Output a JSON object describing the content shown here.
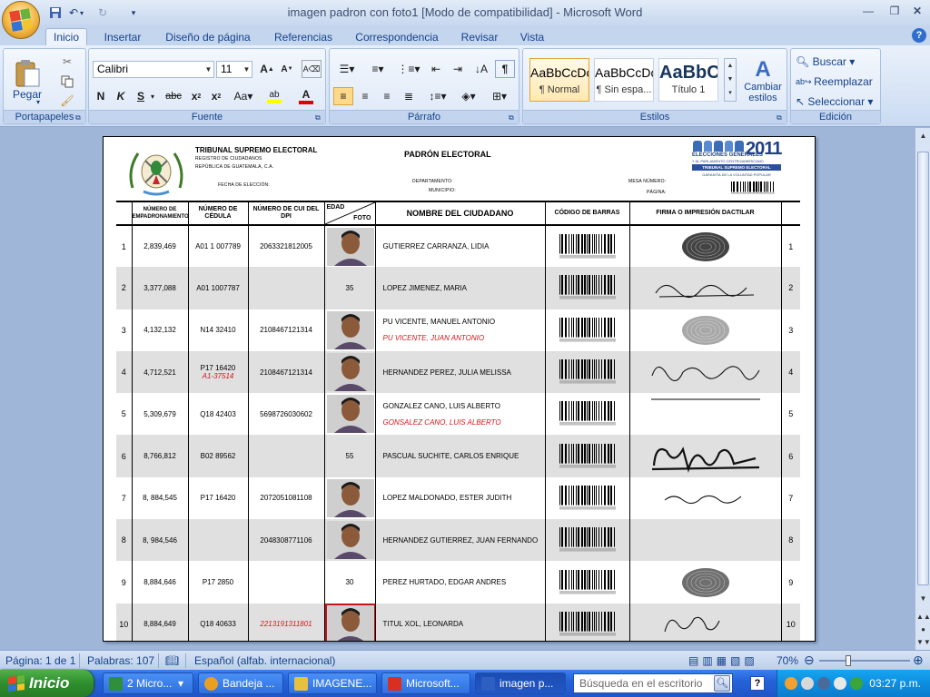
{
  "window": {
    "title": "imagen padron con foto1 [Modo de compatibilidad] - Microsoft Word"
  },
  "tabs": [
    {
      "label": "Inicio",
      "active": true
    },
    {
      "label": "Insertar"
    },
    {
      "label": "Diseño de página"
    },
    {
      "label": "Referencias"
    },
    {
      "label": "Correspondencia"
    },
    {
      "label": "Revisar"
    },
    {
      "label": "Vista"
    }
  ],
  "ribbon": {
    "clipboard": {
      "label": "Portapapeles",
      "paste": "Pegar"
    },
    "font": {
      "label": "Fuente",
      "family": "Calibri",
      "size": "11"
    },
    "paragraph": {
      "label": "Párrafo"
    },
    "styles": {
      "label": "Estilos",
      "items": [
        {
          "sample": "AaBbCcDc",
          "name": "¶ Normal"
        },
        {
          "sample": "AaBbCcDc",
          "name": "¶ Sin espa..."
        },
        {
          "sample": "AaBbC",
          "name": "Título 1"
        }
      ],
      "change": "Cambiar estilos"
    },
    "editing": {
      "label": "Edición",
      "find": "Buscar",
      "replace": "Reemplazar",
      "select": "Seleccionar"
    }
  },
  "page": {
    "org_title": "TRIBUNAL SUPREMO ELECTORAL",
    "org_sub1": "REGISTRO DE CIUDADANOS",
    "org_sub2": "REPÚBLICA DE GUATEMALA,  C.A.",
    "doc_title": "PADRÓN ELECTORAL",
    "fecha_label": "FECHA  DE  ELECCIÓN:",
    "departamento_label": "DEPARTAMENTO:",
    "municipio_label": "MUNICIPIO:",
    "mesa_label": "MESA NÚMERO:",
    "pagina_label": "PÁGINA:",
    "logo_year": "2011",
    "logo_line1": "ELECCIONES GENERALES",
    "logo_line2": "Y AL PARLAMENTO CENTROAMERICANO",
    "logo_line3": "TRIBUNAL SUPREMO ELECTORAL",
    "logo_line4": "GARANTÍA DE LA VOLUNTAD POPULAR"
  },
  "table": {
    "headers": {
      "empadronamiento": "NÚMERO DE EMPADRONAMIENTO",
      "cedula": "NÚMERO DE CÉDULA",
      "cui": "NÚMERO DE CUI DEL DPI",
      "edad": "EDAD",
      "foto": "FOTO",
      "nombre": "NOMBRE DEL CIUDADANO",
      "codigo": "CÓDIGO DE BARRAS",
      "firma": "FIRMA O IMPRESIÓN DACTILAR"
    },
    "rows": [
      {
        "n": "1",
        "emp": "2,839,469",
        "cedula": "A01 1 007789",
        "cedula_note": "",
        "cui": "2063321812005",
        "cui_red": false,
        "age": "",
        "photo": true,
        "name": "GUTIERREZ CARRANZA,  LIDIA",
        "name_note": "",
        "sig": "thumb-dark"
      },
      {
        "n": "2",
        "emp": "3,377,088",
        "cedula": "A01 1007787",
        "cedula_note": "",
        "cui": "",
        "cui_red": false,
        "age": "35",
        "photo": false,
        "name": "LOPEZ JIMENEZ, MARIA",
        "name_note": "",
        "sig": "signature-a"
      },
      {
        "n": "3",
        "emp": "4,132,132",
        "cedula": "N14 32410",
        "cedula_note": "",
        "cui": "2108467121314",
        "cui_red": false,
        "age": "",
        "photo": true,
        "name": "PU VICENTE, MANUEL ANTONIO",
        "name_note": "PU VICENTE, JUAN ANTONIO",
        "sig": "thumb-light"
      },
      {
        "n": "4",
        "emp": "4,712,521",
        "cedula": "P17 16420",
        "cedula_note": "A1-37514",
        "cui": "2108467121314",
        "cui_red": false,
        "age": "",
        "photo": true,
        "name": "HERNANDEZ PEREZ,  JULIA MELISSA",
        "name_note": "",
        "sig": "signature-b"
      },
      {
        "n": "5",
        "emp": "5,309,679",
        "cedula": "Q18 42403",
        "cedula_note": "",
        "cui": "5698726030602",
        "cui_red": false,
        "age": "",
        "photo": true,
        "name": "GONZALEZ CANO,  LUIS ALBERTO",
        "name_note": "GONSALEZ CANO,  LUIS ALBERTO",
        "sig": "line"
      },
      {
        "n": "6",
        "emp": "8,766,812",
        "cedula": "B02 89562",
        "cedula_note": "",
        "cui": "",
        "cui_red": false,
        "age": "55",
        "photo": false,
        "name": "PASCUAL SUCHITE, CARLOS ENRIQUE",
        "name_note": "",
        "sig": "signature-c"
      },
      {
        "n": "7",
        "emp": "8, 884,545",
        "cedula": "P17 16420",
        "cedula_note": "",
        "cui": "2072051081108",
        "cui_red": false,
        "age": "",
        "photo": true,
        "name": "LOPEZ MALDONADO, ESTER JUDITH",
        "name_note": "",
        "sig": "signature-d"
      },
      {
        "n": "8",
        "emp": "8, 984,546",
        "cedula": "",
        "cedula_note": "",
        "cui": "2048308771106",
        "cui_red": false,
        "age": "",
        "photo": true,
        "name": "HERNANDEZ GUTIERREZ,  JUAN  FERNANDO",
        "name_note": "",
        "sig": "none"
      },
      {
        "n": "9",
        "emp": "8,884,646",
        "cedula": "P17 2850",
        "cedula_note": "",
        "cui": "",
        "cui_red": false,
        "age": "30",
        "photo": false,
        "name": "PEREZ HURTADO,  EDGAR  ANDRES",
        "name_note": "",
        "sig": "thumb-mid"
      },
      {
        "n": "10",
        "emp": "8,884,649",
        "cedula": "Q18 40633",
        "cedula_note": "",
        "cui": "2213191311801",
        "cui_red": true,
        "age": "",
        "photo": true,
        "name": "TITUL XOL, LEONARDA",
        "name_note": "",
        "sig": "signature-e"
      }
    ]
  },
  "statusbar": {
    "page": "Página: 1 de 1",
    "words": "Palabras: 107",
    "language": "Español (alfab. internacional)",
    "zoom": "70%"
  },
  "taskbar": {
    "start": "Inicio",
    "buttons": [
      {
        "label": "2 Micro...",
        "color": "#2f8f3a"
      },
      {
        "label": "Bandeja ...",
        "color": "#e8a020"
      },
      {
        "label": "IMAGENE...",
        "color": "#e8c040"
      },
      {
        "label": "Microsoft...",
        "color": "#d83020"
      },
      {
        "label": "imagen p...",
        "color": "#2d5ec2",
        "active": true
      }
    ],
    "search_placeholder": "Búsqueda en el escritorio",
    "clock": "03:27 p.m."
  }
}
